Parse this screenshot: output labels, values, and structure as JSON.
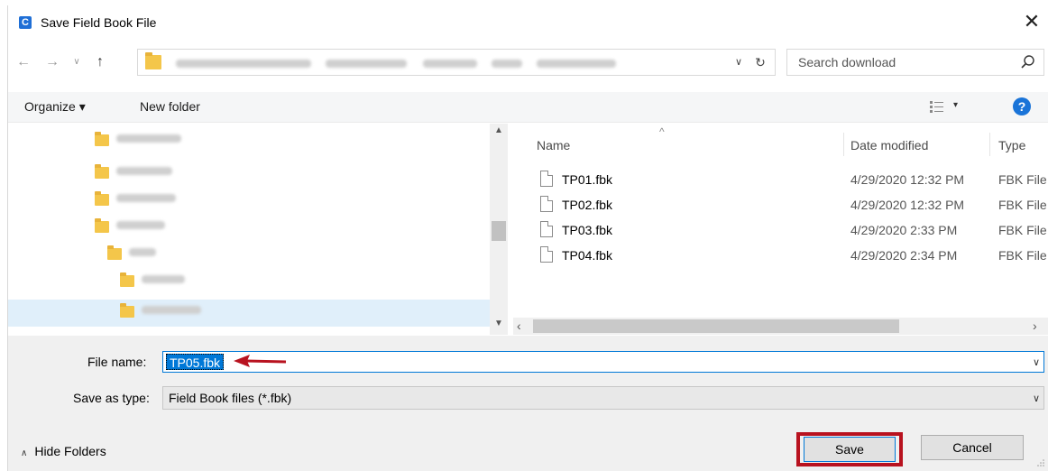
{
  "window": {
    "title": "Save Field Book File",
    "app_icon_letter": "C",
    "close_glyph": "✕"
  },
  "nav": {
    "back_glyph": "←",
    "forward_glyph": "→",
    "recent_glyph": "∨",
    "up_glyph": "↑",
    "dropdown_glyph": "∨",
    "refresh_glyph": "↻"
  },
  "search": {
    "placeholder": "Search download"
  },
  "toolbar": {
    "organize_label": "Organize ▾",
    "new_folder_label": "New folder",
    "view_arrow": "▾",
    "help_label": "?"
  },
  "file_list": {
    "columns": {
      "name": "Name",
      "date_modified": "Date modified",
      "type": "Type"
    },
    "files": [
      {
        "name": "TP01.fbk",
        "date": "4/29/2020 12:32 PM",
        "type": "FBK File"
      },
      {
        "name": "TP02.fbk",
        "date": "4/29/2020 12:32 PM",
        "type": "FBK File"
      },
      {
        "name": "TP03.fbk",
        "date": "4/29/2020 2:33 PM",
        "type": "FBK File"
      },
      {
        "name": "TP04.fbk",
        "date": "4/29/2020 2:34 PM",
        "type": "FBK File"
      }
    ]
  },
  "form": {
    "file_name_label": "File name:",
    "file_name_value": "TP05.fbk",
    "save_as_type_label": "Save as type:",
    "save_as_type_value": "Field Book files (*.fbk)",
    "chevron": "∨"
  },
  "footer": {
    "hide_folders_caret": "∧",
    "hide_folders_label": "Hide Folders",
    "save_label": "Save",
    "cancel_label": "Cancel"
  },
  "colors": {
    "accent": "#0078d7",
    "highlight_red": "#b8121f",
    "folder_yellow": "#f4c64a"
  }
}
